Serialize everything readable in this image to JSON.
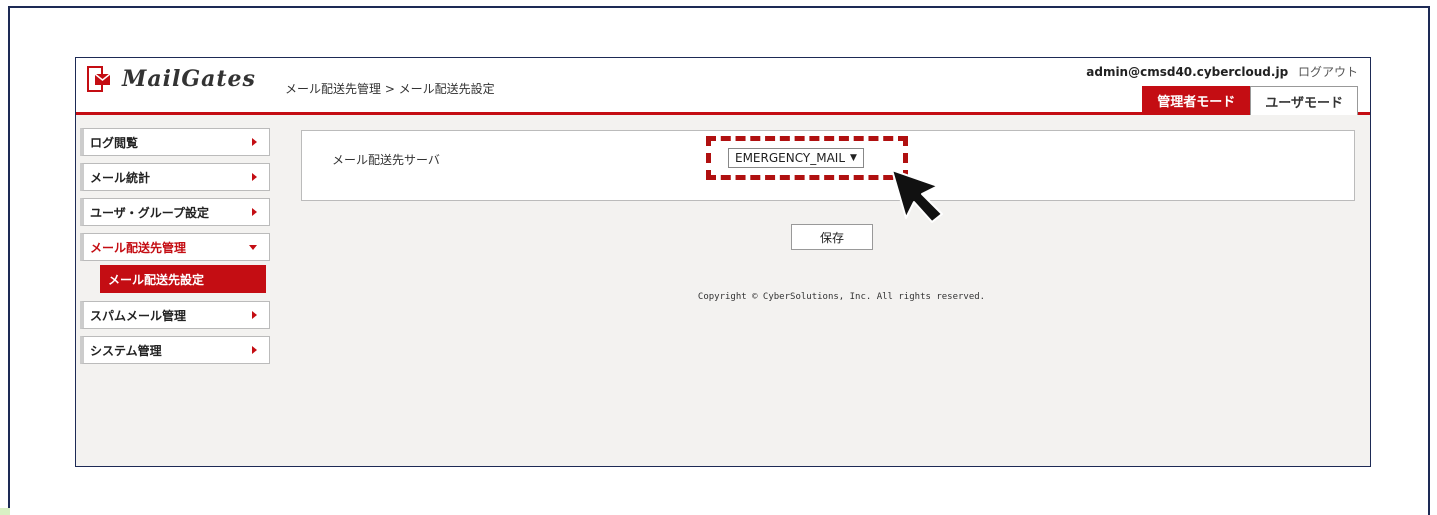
{
  "header": {
    "logo_text": "MailGates",
    "breadcrumb": "メール配送先管理 > メール配送先設定",
    "user_email": "admin@cmsd40.cybercloud.jp",
    "logout_label": "ログアウト",
    "mode_tabs": [
      {
        "label": "管理者モード",
        "active": true
      },
      {
        "label": "ユーザモード",
        "active": false
      }
    ]
  },
  "sidebar": {
    "items": [
      {
        "label": "ログ閲覧"
      },
      {
        "label": "メール統計"
      },
      {
        "label": "ユーザ・グループ設定"
      },
      {
        "label": "メール配送先管理",
        "open": true
      },
      {
        "label": "スパムメール管理"
      },
      {
        "label": "システム管理"
      }
    ],
    "submenu": {
      "label": "メール配送先設定"
    }
  },
  "form": {
    "field_label": "メール配送先サーバ",
    "server_select_value": "EMERGENCY_MAIL",
    "save_label": "保存"
  },
  "footer": {
    "copyright": "Copyright © CyberSolutions, Inc. All rights reserved."
  },
  "colors": {
    "brand_red": "#c40d13",
    "frame_navy": "#1d2a55"
  }
}
